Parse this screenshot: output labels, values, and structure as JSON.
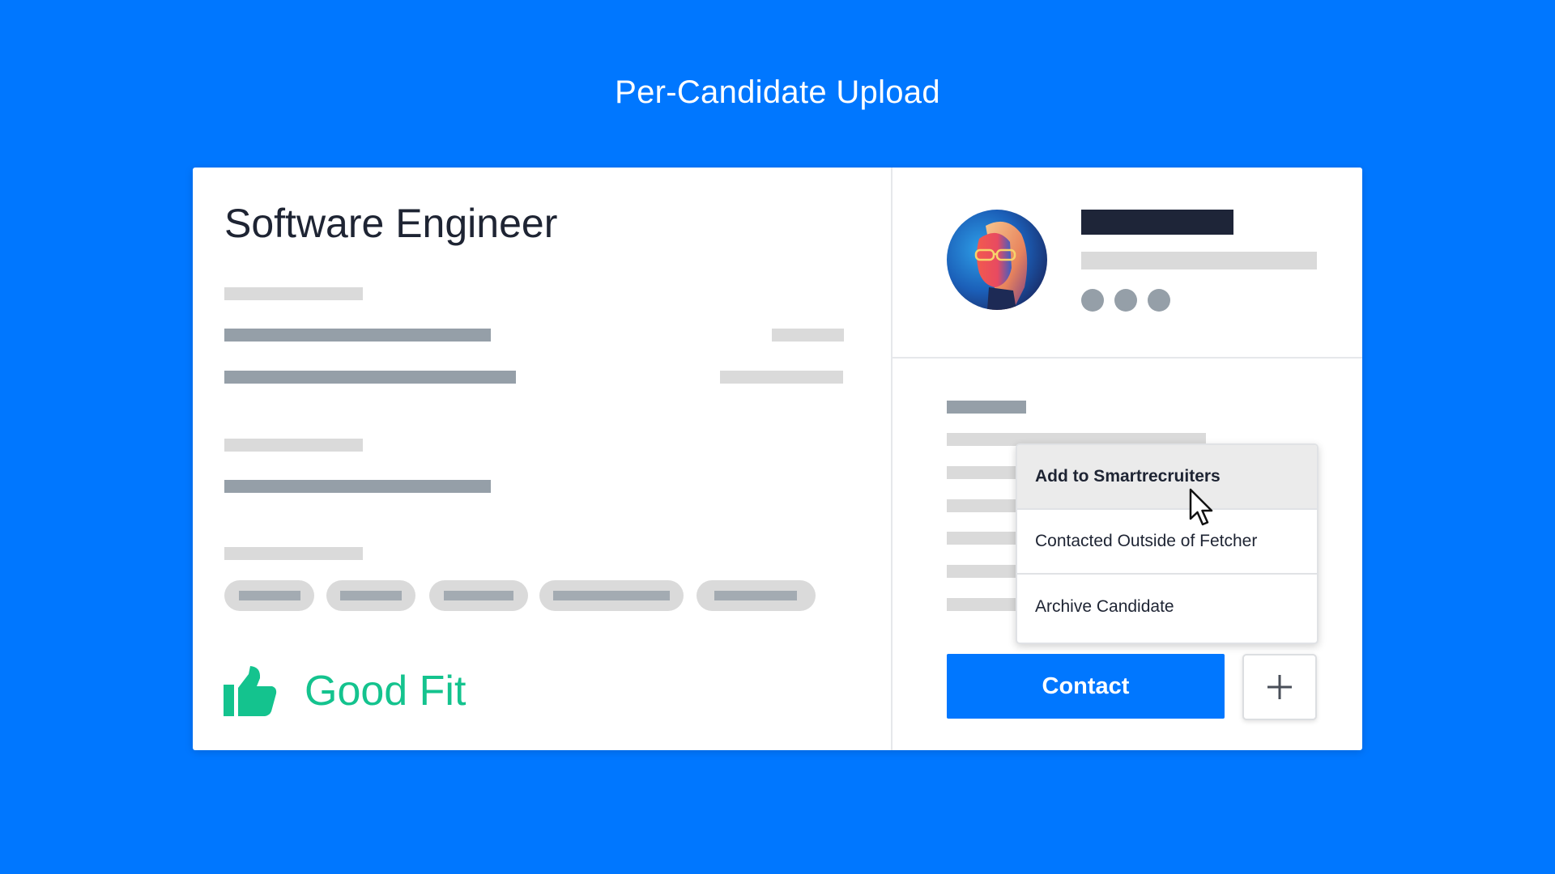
{
  "header": {
    "title": "Per-Candidate Upload"
  },
  "job": {
    "title": "Software Engineer"
  },
  "evaluation": {
    "label": "Good Fit",
    "icon": "thumbs-up-icon",
    "color": "#14C38E"
  },
  "candidate": {
    "avatar_icon": "avatar"
  },
  "actions_menu": {
    "items": [
      {
        "label": "Add to Smartrecruiters"
      },
      {
        "label": "Contacted Outside of Fetcher"
      },
      {
        "label": "Archive Candidate"
      }
    ]
  },
  "buttons": {
    "contact_label": "Contact",
    "more_icon": "plus-icon"
  },
  "colors": {
    "background": "#0077FF",
    "accent": "#0077FF",
    "good_fit": "#14C38E"
  }
}
